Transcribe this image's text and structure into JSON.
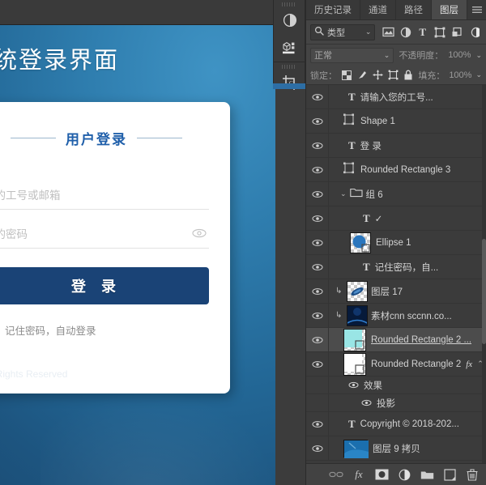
{
  "document": {
    "title": "统登录界面",
    "card": {
      "heading": "用户登录",
      "username_placeholder": "您的工号或邮箱",
      "password_placeholder": "您的密码",
      "eye_icon": "eye-icon",
      "login_button": "登 录",
      "remember_label": "记住密码，自动登录",
      "check_glyph": "✓"
    },
    "footer": "ll Rights Reserved",
    "colors": {
      "background_blue": "#2f7eaf",
      "button_navy": "#1a4376",
      "heading_blue": "#1f5faa",
      "check_blue": "#1d72bf"
    }
  },
  "tool_palette": {
    "buttons": [
      {
        "name": "adjustments-icon",
        "label": "调整"
      },
      {
        "name": "properties-3d-icon",
        "label": "属性"
      },
      {
        "name": "crop-tool-icon",
        "label": "裁剪工具"
      }
    ]
  },
  "panel": {
    "tabs": [
      {
        "label": "历史记录",
        "active": false
      },
      {
        "label": "通道",
        "active": false
      },
      {
        "label": "路径",
        "active": false
      },
      {
        "label": "图层",
        "active": true
      }
    ],
    "menu_icon": "panel-menu-icon",
    "filter": {
      "search_icon": "search-icon",
      "type_value": "类型",
      "chevron": "⌄",
      "icons": [
        {
          "name": "filter-pixel-icon"
        },
        {
          "name": "filter-adjustment-icon"
        },
        {
          "name": "filter-type-icon",
          "glyph": "T"
        },
        {
          "name": "filter-shape-icon"
        },
        {
          "name": "filter-smartobject-icon"
        },
        {
          "name": "filter-toggle-icon"
        }
      ]
    },
    "blend": {
      "mode": "正常",
      "chevron": "⌄",
      "opacity_label": "不透明度：",
      "opacity_value": "100%"
    },
    "lock": {
      "label": "锁定：",
      "icons": [
        {
          "name": "lock-transparent-icon"
        },
        {
          "name": "lock-image-icon"
        },
        {
          "name": "lock-position-icon"
        },
        {
          "name": "lock-artboard-icon"
        },
        {
          "name": "lock-all-icon"
        }
      ],
      "fill_label": "填充：",
      "fill_value": "100%"
    },
    "layers": [
      {
        "kind": "type",
        "name": "请输入您的工号...",
        "visible": true,
        "indent": 0,
        "selected": false
      },
      {
        "kind": "shape",
        "name": "Shape 1",
        "visible": true,
        "indent": 0,
        "selected": false
      },
      {
        "kind": "type",
        "name": "登 录",
        "visible": true,
        "indent": 0,
        "selected": false
      },
      {
        "kind": "shape",
        "name": "Rounded Rectangle 3",
        "visible": true,
        "indent": 0,
        "selected": false
      },
      {
        "kind": "group",
        "name": "组 6",
        "visible": true,
        "indent": 0,
        "selected": false,
        "expanded": true
      },
      {
        "kind": "type",
        "name": "✓",
        "visible": true,
        "indent": 1,
        "selected": false
      },
      {
        "kind": "pixel",
        "name": "Ellipse 1",
        "visible": true,
        "indent": 1,
        "selected": false,
        "thumb": "ellipse-blue"
      },
      {
        "kind": "type",
        "name": "记住密码，自...",
        "visible": true,
        "indent": 1,
        "selected": false
      },
      {
        "kind": "pixel",
        "name": "图层 17",
        "visible": true,
        "indent": 0,
        "selected": false,
        "clipped": true,
        "thumb": "streak-blue"
      },
      {
        "kind": "pixel",
        "name": "素材cnn sccnn.co...",
        "visible": true,
        "indent": 0,
        "selected": false,
        "clipped": true,
        "thumb": "dark-blue"
      },
      {
        "kind": "pixel",
        "name": "Rounded Rectangle 2 ...",
        "visible": true,
        "indent": 0,
        "selected": true,
        "underlined": true,
        "thumb": "cyan"
      },
      {
        "kind": "pixel",
        "name": "Rounded Rectangle 2",
        "visible": true,
        "indent": 0,
        "selected": false,
        "fx": "fx",
        "chevron": "⌃",
        "thumb": "white"
      },
      {
        "kind": "effect",
        "name": "效果",
        "visible": true,
        "indent": 1,
        "selected": false
      },
      {
        "kind": "effect",
        "name": "投影",
        "visible": true,
        "indent": 2,
        "selected": false
      },
      {
        "kind": "type",
        "name": "Copyright © 2018-202...",
        "visible": true,
        "indent": 0,
        "selected": false
      },
      {
        "kind": "pixel",
        "name": "图层 9 拷贝",
        "visible": true,
        "indent": 0,
        "selected": false,
        "thumb": "photo-blue"
      }
    ],
    "bottom_buttons": [
      {
        "name": "link-layers-button",
        "glyph": "GO"
      },
      {
        "name": "layer-style-button",
        "glyph": "fx"
      },
      {
        "name": "layer-mask-button"
      },
      {
        "name": "adjustment-layer-button"
      },
      {
        "name": "new-group-button"
      },
      {
        "name": "new-layer-button"
      },
      {
        "name": "delete-layer-button"
      }
    ]
  }
}
